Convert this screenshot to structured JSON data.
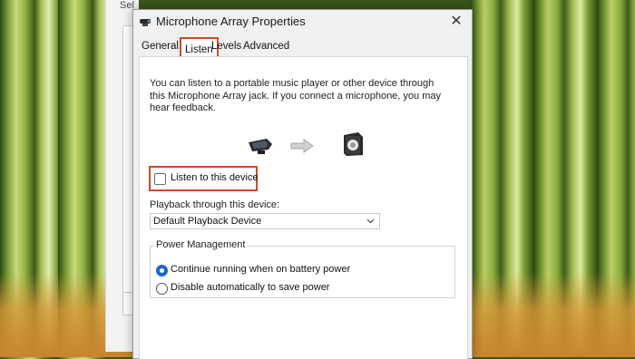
{
  "background": {
    "description_color": "#6f9230"
  },
  "back_window": {
    "top_text": "Sel"
  },
  "dialog": {
    "title": "Microphone Array Properties",
    "title_icon": "microphone-array-icon",
    "close_label": "✕",
    "tabs": [
      {
        "label": "General",
        "active": false
      },
      {
        "label": "Listen",
        "active": true
      },
      {
        "label": "Levels",
        "active": false
      },
      {
        "label": "Advanced",
        "active": false
      }
    ],
    "listen": {
      "description": "You can listen to a portable music player or other device through this Microphone Array jack.  If you connect a microphone, you may hear feedback.",
      "icons": [
        "webcam-microphone-icon",
        "right-arrow-icon",
        "speaker-icon"
      ],
      "listen_checkbox": {
        "label": "Listen to this device",
        "checked": false
      },
      "playback_label": "Playback through this device:",
      "playback_value": "Default Playback Device",
      "power_management": {
        "title": "Power Management",
        "options": [
          {
            "label": "Continue running when on battery power",
            "selected": true
          },
          {
            "label": "Disable automatically to save power",
            "selected": false
          }
        ]
      }
    },
    "accent_color": "#c94a2a",
    "selection_color": "#1f64c8"
  }
}
